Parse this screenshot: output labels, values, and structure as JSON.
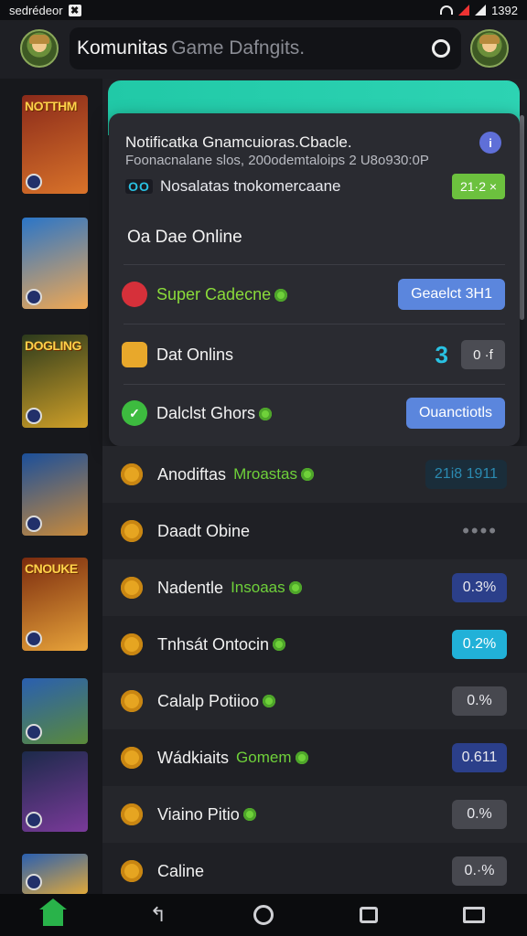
{
  "status_bar": {
    "left_text": "sedrédeor",
    "box_glyph": "✖",
    "time": "1392"
  },
  "header": {
    "search_text": "Komunitas",
    "search_hint": "Game Dafngits."
  },
  "card": {
    "title": "Notificatka Gnamcuioras.Cbacle.",
    "subtitle": "Foonacnalane slos, 200odemtaloips 2 U8o930:0P",
    "tag_icon": "OO",
    "tag_text": "Nosalatas tnokomercaane",
    "green_pill": "21·2 ×",
    "section": "Oa Dae Online",
    "rows": [
      {
        "label": "Super Cadecne",
        "button": "Geaelct 3H1",
        "icon_color": "#d6303a"
      },
      {
        "label": "Dat Onlins",
        "big_num": "3",
        "gray_btn": "0 ·f",
        "icon_color": "#e8a82b"
      },
      {
        "label": "Dalclst Ghors",
        "button": "Ouanctiotls",
        "icon_color": "#3dbb3f"
      }
    ],
    "info_icon": "i"
  },
  "list": [
    {
      "label": "Anodiftas",
      "sub": "Mroastas",
      "pill": "21i8 1911",
      "pill_style": "dark"
    },
    {
      "label": "Daadt Obine",
      "dots": "••••"
    },
    {
      "label": "Nadentle",
      "sub": "Insoaas",
      "pill": "0.3%",
      "pill_style": "navy"
    },
    {
      "label": "Tnhsát Ontocin",
      "pill": "0.2%",
      "pill_style": "cyan"
    },
    {
      "label": "Calalp Potiioo",
      "pill": "0.%",
      "pill_style": "gray"
    },
    {
      "label": "Wádkiaits",
      "sub": "Gomem",
      "pill": "0.611",
      "pill_style": "navy"
    },
    {
      "label": "Viaino Pitio",
      "pill": "0.%",
      "pill_style": "gray"
    },
    {
      "label": "Caline",
      "pill": "0.·%",
      "pill_style": "gray"
    }
  ],
  "sidebar": {
    "thumbs": [
      {
        "title": "NOTTHM",
        "colors": [
          "#8a2a1a",
          "#d9732a"
        ]
      },
      {
        "title": "",
        "colors": [
          "#2a75c8",
          "#f1a852"
        ]
      },
      {
        "title": "DOGLING",
        "colors": [
          "#2c3a1c",
          "#d0a028"
        ]
      },
      {
        "title": "",
        "colors": [
          "#1b4f9a",
          "#c98a3a"
        ]
      },
      {
        "title": "CNOUKE",
        "colors": [
          "#7a2a0e",
          "#e8a43a"
        ]
      },
      {
        "title": "",
        "colors": [
          "#2a5fb0",
          "#5a8a3a"
        ]
      },
      {
        "title": "",
        "colors": [
          "#1c2a4a",
          "#7a3a9a"
        ]
      },
      {
        "title": "",
        "colors": [
          "#2a5fb0",
          "#e0a83a"
        ]
      }
    ]
  },
  "nav": {
    "back_glyph": "↰"
  }
}
